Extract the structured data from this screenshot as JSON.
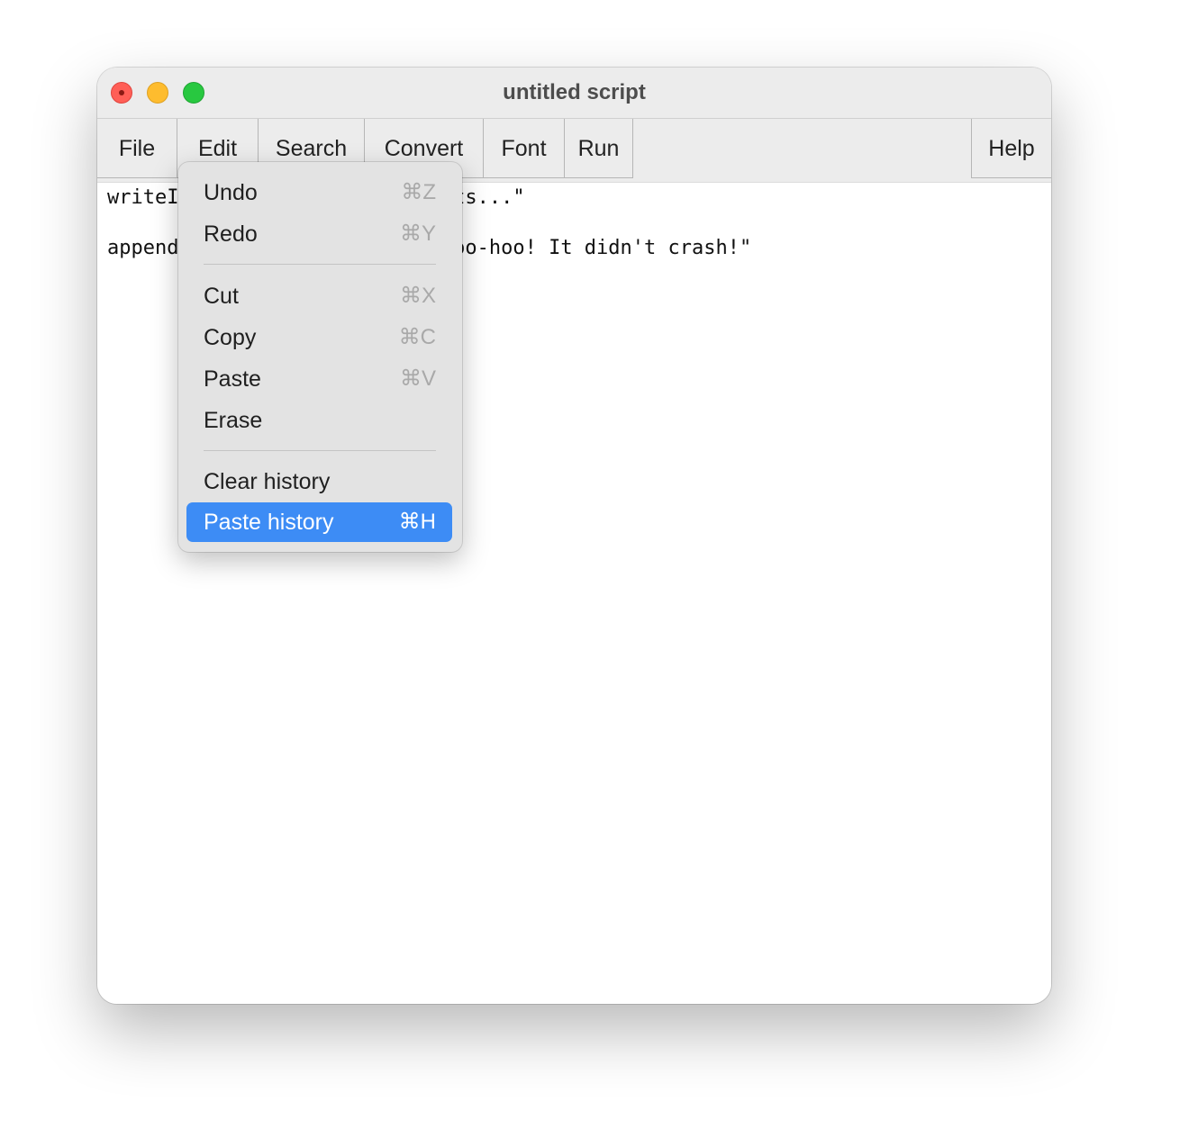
{
  "window": {
    "title": "untitled script"
  },
  "menubar": {
    "items": [
      {
        "label": "File"
      },
      {
        "label": "Edit"
      },
      {
        "label": "Search"
      },
      {
        "label": "Convert"
      },
      {
        "label": "Font"
      },
      {
        "label": "Run"
      }
    ],
    "help": {
      "label": "Help"
    }
  },
  "editor": {
    "lines": [
      {
        "text": "writeInfoLine: \"Hello, formants...\""
      },
      {
        "text": "appendInfoLine: newline$, \"Whoo-hoo! It didn't crash!\""
      }
    ]
  },
  "edit_menu": {
    "items": [
      {
        "label": "Undo",
        "shortcut": "⌘Z",
        "enabled": true
      },
      {
        "label": "Redo",
        "shortcut": "⌘Y",
        "enabled": true
      },
      {
        "label": "Cut",
        "shortcut": "⌘X",
        "enabled": true
      },
      {
        "label": "Copy",
        "shortcut": "⌘C",
        "enabled": true
      },
      {
        "label": "Paste",
        "shortcut": "⌘V",
        "enabled": true
      },
      {
        "label": "Erase",
        "shortcut": "",
        "enabled": true
      },
      {
        "label": "Clear history",
        "shortcut": "",
        "enabled": true
      },
      {
        "label": "Paste history",
        "shortcut": "⌘H",
        "enabled": true,
        "highlighted": true
      }
    ]
  },
  "colors": {
    "highlight": "#3d8cf5",
    "close": "#ff5f57",
    "minimize": "#febc2e",
    "maximize": "#28c840"
  }
}
